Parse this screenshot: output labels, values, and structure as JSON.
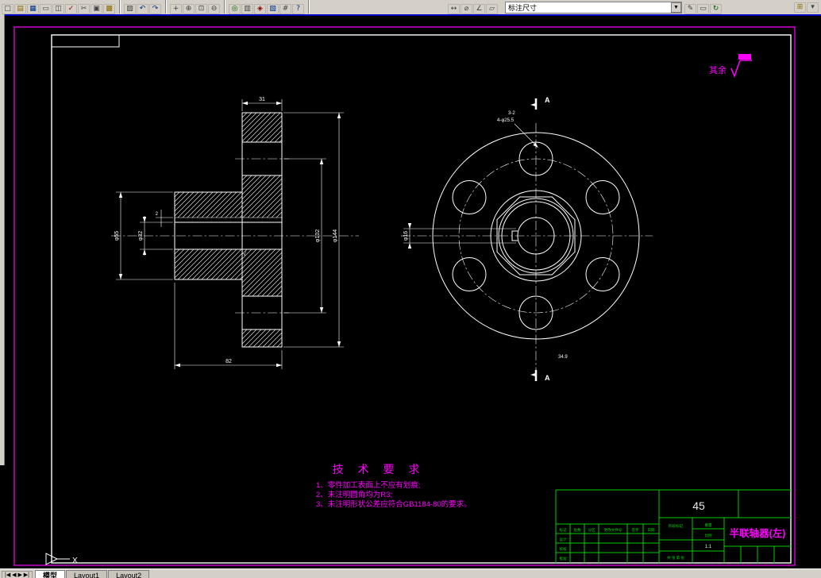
{
  "toolbar": {
    "groups": [
      {
        "items": [
          {
            "name": "new",
            "glyph": "□",
            "color": "#404040"
          },
          {
            "name": "open",
            "glyph": "▤",
            "color": "#8a6d00"
          },
          {
            "name": "save",
            "glyph": "▦",
            "color": "#00308a"
          },
          {
            "name": "print",
            "glyph": "▭",
            "color": "#404040"
          },
          {
            "name": "print-preview",
            "glyph": "◫",
            "color": "#404040"
          },
          {
            "name": "spell",
            "glyph": "✓",
            "color": "#8a0000"
          },
          {
            "name": "cut",
            "glyph": "✂",
            "color": "#404040"
          },
          {
            "name": "copy",
            "glyph": "▣",
            "color": "#404040"
          },
          {
            "name": "paste",
            "glyph": "▩",
            "color": "#8a6d00"
          }
        ]
      },
      {
        "items": [
          {
            "name": "match-properties",
            "glyph": "▨",
            "color": "#404040"
          },
          {
            "name": "undo",
            "glyph": "↶",
            "color": "#00308a"
          },
          {
            "name": "redo",
            "glyph": "↷",
            "color": "#00308a"
          }
        ]
      },
      {
        "items": [
          {
            "name": "pan",
            "glyph": "+",
            "color": "#404040"
          },
          {
            "name": "zoom-realtime",
            "glyph": "⊕",
            "color": "#404040"
          },
          {
            "name": "zoom-window",
            "glyph": "⊡",
            "color": "#404040"
          },
          {
            "name": "zoom-previous",
            "glyph": "⊖",
            "color": "#404040"
          }
        ]
      },
      {
        "items": [
          {
            "name": "aerial-view",
            "glyph": "◎",
            "color": "#006000"
          },
          {
            "name": "named-views",
            "glyph": "▥",
            "color": "#404040"
          },
          {
            "name": "redraw",
            "glyph": "◈",
            "color": "#8a0000"
          },
          {
            "name": "properties",
            "glyph": "▧",
            "color": "#00308a"
          },
          {
            "name": "distance",
            "glyph": "#",
            "color": "#404040"
          },
          {
            "name": "help-context",
            "glyph": "?",
            "color": "#00308a"
          }
        ]
      },
      {
        "items": [
          {
            "name": "dim-linear",
            "glyph": "↔",
            "color": "#404040"
          },
          {
            "name": "dim-diameter",
            "glyph": "⌀",
            "color": "#404040"
          },
          {
            "name": "dim-angular",
            "glyph": "∠",
            "color": "#404040"
          },
          {
            "name": "dim-style",
            "glyph": "▱",
            "color": "#404040"
          }
        ]
      }
    ],
    "style_dropdown": {
      "value": "标注尺寸"
    },
    "right_items": [
      {
        "name": "dim-edit",
        "glyph": "✎",
        "color": "#404040"
      },
      {
        "name": "dim-text-edit",
        "glyph": "▭",
        "color": "#404040"
      },
      {
        "name": "dim-update",
        "glyph": "↻",
        "color": "#006000"
      }
    ],
    "far_items": [
      {
        "name": "osnap-settings",
        "glyph": "⊞",
        "color": "#8a6d00"
      },
      {
        "name": "toolbar-options",
        "glyph": "▾",
        "color": "#404040"
      }
    ]
  },
  "drawing": {
    "surface_note": "其余",
    "ucs_label": "X",
    "section_label": "A",
    "left_view": {
      "dim_top": "31",
      "dim_bottom": "82",
      "dim_key": "2",
      "dia_bore": "φ32",
      "dia_hub": "φ55",
      "dia_inner": "φ102",
      "dia_outer": "φ144",
      "roughness_mark": "√"
    },
    "right_view": {
      "hole_note_1": "3-2",
      "hole_note_2": "4-φ25.5",
      "dia_left": "φ16",
      "dim_bottom": "34.9"
    },
    "tech": {
      "title": "技 术 要 求",
      "items": [
        "1、零件加工表面上不应有划痕;",
        "2、未注明圆角均为R3;",
        "3、未注明形状公差应符合GB1184-80的要求。"
      ]
    }
  },
  "title_block": {
    "material": "45",
    "part_name": "半联轴器(左)",
    "header_labels": [
      "标记",
      "处数",
      "分区",
      "更改文件号",
      "签字",
      "日期"
    ],
    "row_labels": [
      "设计",
      "校核",
      "批准"
    ],
    "stage_label": "阶段标记",
    "weight_label": "重量",
    "scale_label": "比例",
    "scale_value": "1:1",
    "sheets_label": "共 张 第 张"
  },
  "tabs": {
    "nav": "|◀ ◀ ▶ ▶|",
    "items": [
      "模型",
      "Layout1",
      "Layout2"
    ]
  }
}
